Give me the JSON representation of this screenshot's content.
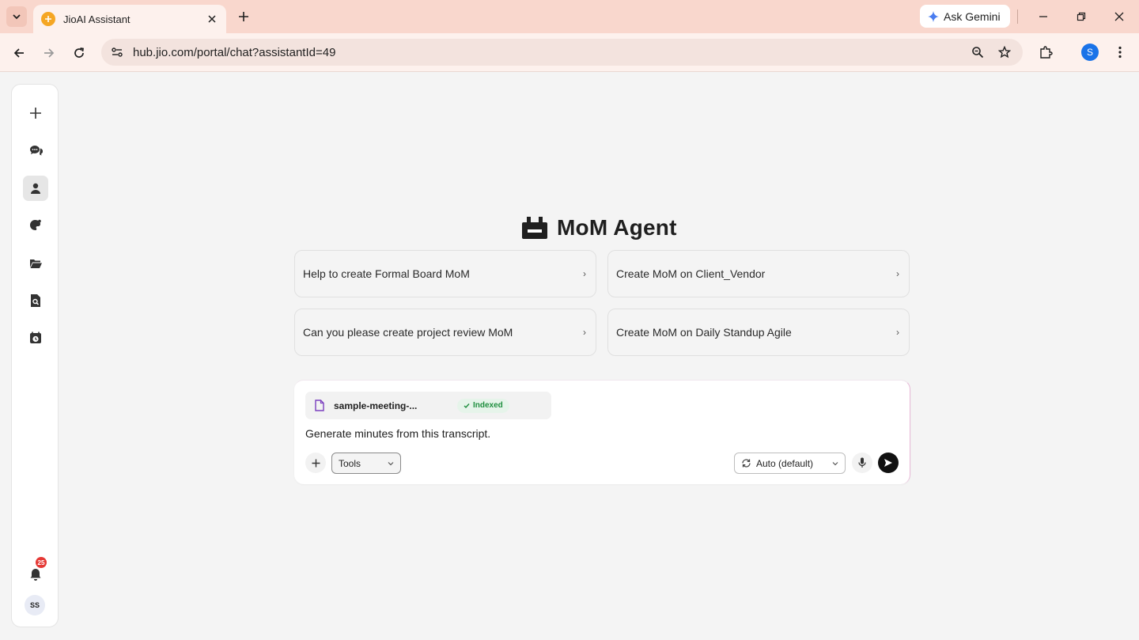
{
  "browser": {
    "tab_title": "JioAI Assistant",
    "url": "hub.jio.com/portal/chat?assistantId=49",
    "gemini_label": "Ask Gemini",
    "profile_initial": "S"
  },
  "sidebar": {
    "items": [
      {
        "name": "new-chat",
        "icon": "plus-icon"
      },
      {
        "name": "chats",
        "icon": "chat-bubbles-icon"
      },
      {
        "name": "agents",
        "icon": "person-icon",
        "active": true
      },
      {
        "name": "tools",
        "icon": "palette-icon"
      },
      {
        "name": "files",
        "icon": "folder-open-icon"
      },
      {
        "name": "search-docs",
        "icon": "doc-search-icon"
      },
      {
        "name": "schedule",
        "icon": "calendar-clock-icon"
      }
    ],
    "notification_count": "25",
    "avatar_initials": "SS"
  },
  "agent": {
    "title": "MoM Agent",
    "icon": "robot-icon"
  },
  "prompts": [
    {
      "label": "Help to create Formal Board MoM"
    },
    {
      "label": "Create MoM on Client_Vendor"
    },
    {
      "label": "Can you please create project review MoM"
    },
    {
      "label": "Create MoM on Daily Standup Agile"
    }
  ],
  "composer": {
    "file_name": "sample-meeting-...",
    "file_status": "Indexed",
    "message": "Generate minutes from this transcript.",
    "tools_label": "Tools",
    "model_label": "Auto (default)"
  },
  "colors": {
    "tabstrip": "#f9d7cd",
    "toolbar": "#fdf1ed",
    "page_bg": "#f4f4f4",
    "badge": "#e53935",
    "indexed_green": "#1e8e3e",
    "send_button": "#111111"
  }
}
